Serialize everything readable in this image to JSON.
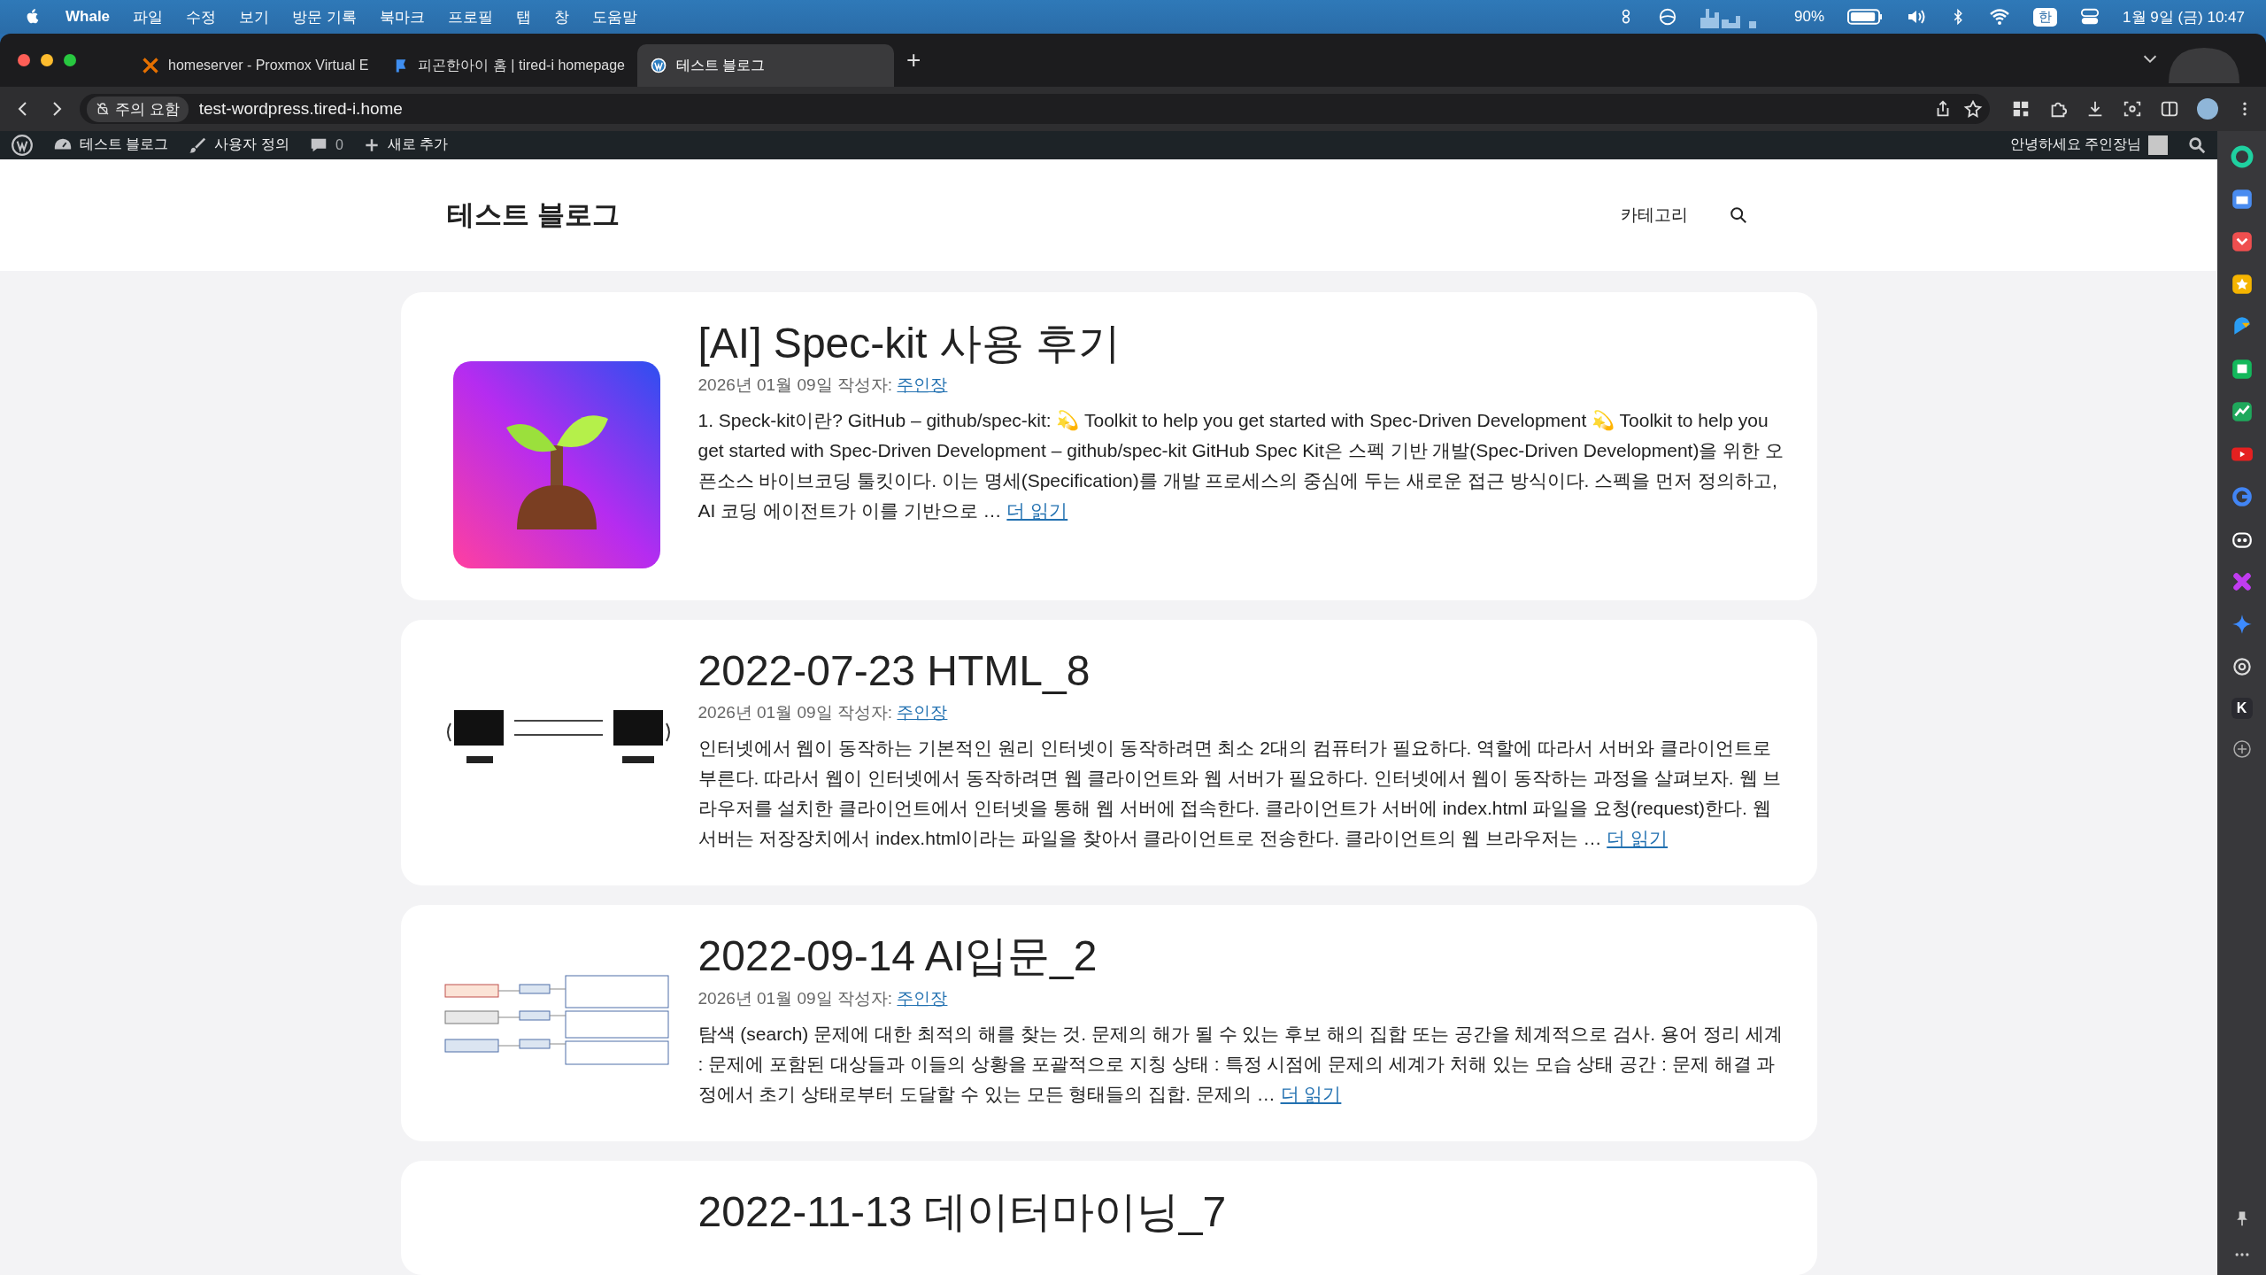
{
  "menubar": {
    "app": "Whale",
    "menus": [
      "파일",
      "수정",
      "보기",
      "방문 기록",
      "북마크",
      "프로필",
      "탭",
      "창",
      "도움말"
    ],
    "battery": "90%",
    "input_method": "한",
    "clock": "1월 9일 (금) 10:47"
  },
  "tabs": [
    {
      "title": "homeserver - Proxmox Virtual E",
      "kind": "proxmox",
      "selected": false
    },
    {
      "title": "피곤한아이 홈 | tired-i homepage",
      "kind": "flag",
      "selected": false
    },
    {
      "title": "테스트 블로그",
      "kind": "wordpress",
      "selected": true
    }
  ],
  "new_tab": "+",
  "address_bar": {
    "security": "주의 요함",
    "url": "test-wordpress.tired-i.home"
  },
  "admin_bar": {
    "site": "테스트 블로그",
    "customize": "사용자 정의",
    "comments": "0",
    "new": "새로 추가",
    "greeting": "안녕하세요 주인장님"
  },
  "site": {
    "title": "테스트 블로그",
    "nav": [
      "카테고리"
    ]
  },
  "posts": [
    {
      "title": "[AI] Spec-kit 사용 후기",
      "kind": "plant",
      "date": "2026년 01월 09일",
      "by": "작성자:",
      "author": "주인장",
      "excerpt": "1. Speck-kit이란? GitHub – github/spec-kit: 💫 Toolkit to help you get started with Spec-Driven Development 💫 Toolkit to help you get started with Spec-Driven Development – github/spec-kit GitHub Spec Kit은 스펙 기반 개발(Spec-Driven Development)을 위한 오픈소스 바이브코딩 툴킷이다. 이는 명세(Specification)를 개발 프로세스의 중심에 두는 새로운 접근 방식이다. 스펙을 먼저 정의하고, AI 코딩 에이전트가 이를 기반으로 …",
      "more": "더 읽기"
    },
    {
      "title": "2022-07-23 HTML_8",
      "kind": "network",
      "date": "2026년 01월 09일",
      "by": "작성자:",
      "author": "주인장",
      "excerpt": "인터넷에서 웹이 동작하는 기본적인 원리 인터넷이 동작하려면 최소 2대의 컴퓨터가 필요하다. 역할에 따라서 서버와 클라이언트로 부른다. 따라서 웹이 인터넷에서 동작하려면 웹 클라이언트와 웹 서버가 필요하다. 인터넷에서 웹이 동작하는 과정을 살펴보자. 웹 브라우저를 설치한 클라이언트에서 인터넷을 통해 웹 서버에 접속한다. 클라이언트가 서버에 index.html 파일을 요청(request)한다. 웹 서버는 저장장치에서 index.html이라는 파일을 찾아서 클라이언트로 전송한다. 클라이언트의 웹 브라우저는 …",
      "more": "더 읽기"
    },
    {
      "title": "2022-09-14 AI입문_2",
      "kind": "table",
      "date": "2026년 01월 09일",
      "by": "작성자:",
      "author": "주인장",
      "excerpt": "탐색 (search) 문제에 대한 최적의 해를 찾는 것. 문제의 해가 될 수 있는 후보 해의 집합 또는 공간을 체계적으로 검사. 용어 정리 세계 : 문제에 포함된 대상들과 이들의 상황을 포괄적으로 지칭 상태 : 특정 시점에 문제의 세계가 처해 있는 모습 상태 공간 : 문제 해결 과정에서 초기 상태로부터 도달할 수 있는 모든 형태들의 집합. 문제의 …",
      "more": "더 읽기"
    },
    {
      "title": "2022-11-13 데이터마이닝_7"
    }
  ],
  "sidebar_apps": [
    {
      "kind": "ring",
      "color": "#1fd1a0"
    },
    {
      "kind": "briefcase",
      "color": "#4a8cf0"
    },
    {
      "kind": "pocket",
      "color": "#ef4f4f"
    },
    {
      "kind": "star",
      "color": "#f5b400"
    },
    {
      "kind": "bird",
      "color": "#2a9df4"
    },
    {
      "kind": "note",
      "color": "#13b85c"
    },
    {
      "kind": "chart",
      "color": "#1fa85c"
    },
    {
      "kind": "play",
      "color": "#e52020"
    },
    {
      "kind": "google",
      "color": "#4285f4"
    },
    {
      "kind": "bot",
      "color": "#ffffff"
    },
    {
      "kind": "cross",
      "color": "#c03cf0"
    },
    {
      "kind": "sparkle",
      "color": "#3d8bff"
    },
    {
      "kind": "knot",
      "color": "#dddddd"
    },
    {
      "kind": "letter",
      "color": "#2a2a30",
      "label": "K"
    }
  ]
}
